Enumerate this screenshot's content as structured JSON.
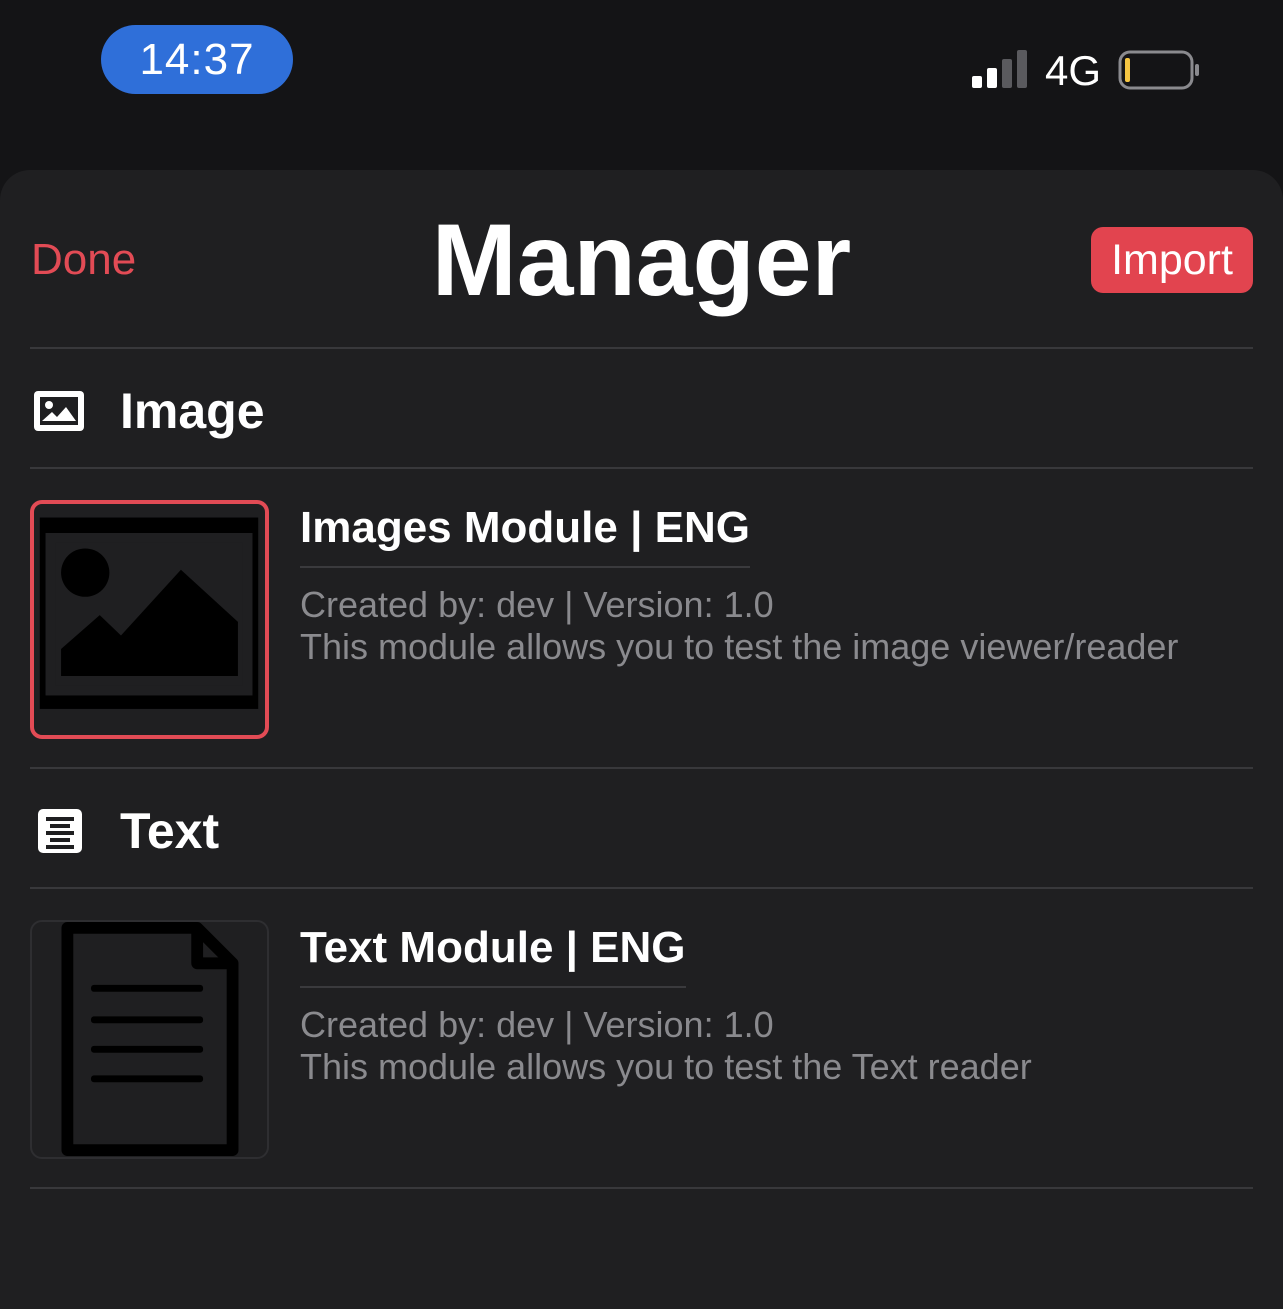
{
  "status_bar": {
    "time": "14:37",
    "network": "4G",
    "signal_bars_filled": 2,
    "signal_bars_total": 4,
    "battery_level": 0.1,
    "accent_color": "#2f6fd9"
  },
  "header": {
    "done_label": "Done",
    "title": "Manager",
    "import_label": "Import",
    "accent_color": "#e2444f"
  },
  "sections": [
    {
      "label": "Image",
      "icon": "photo-icon",
      "modules": [
        {
          "title": "Images Module | ENG",
          "meta": "Created by: dev | Version: 1.0",
          "description": "This module allows you to test the image viewer/reader",
          "thumbnail_icon": "image-placeholder-icon",
          "selected": true
        }
      ]
    },
    {
      "label": "Text",
      "icon": "text-document-icon",
      "modules": [
        {
          "title": "Text Module | ENG",
          "meta": "Created by: dev | Version: 1.0",
          "description": "This module allows you to test the Text reader",
          "thumbnail_icon": "document-icon",
          "selected": false
        }
      ]
    }
  ]
}
